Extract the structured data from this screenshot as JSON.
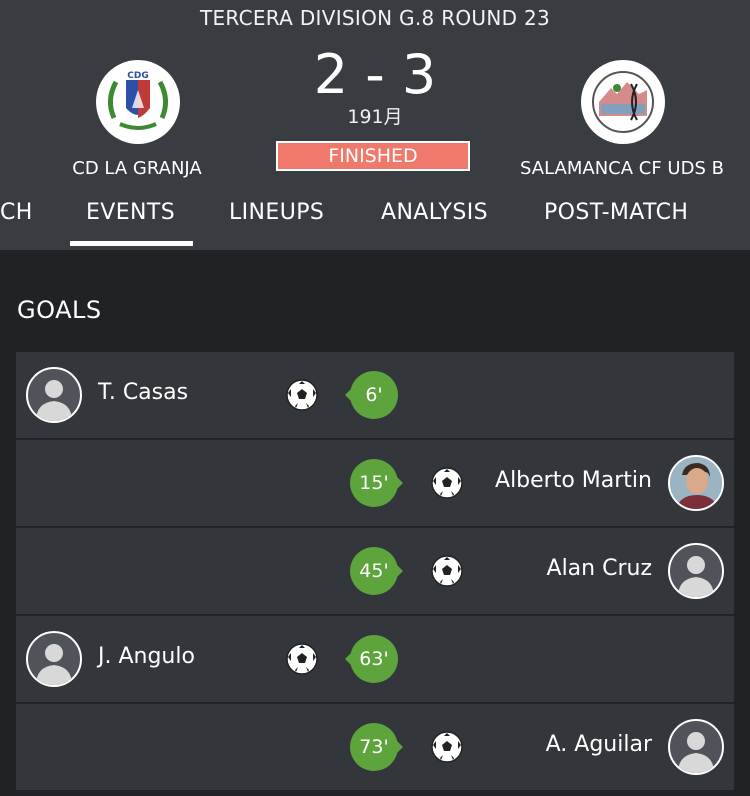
{
  "match": {
    "competition": "TERCERA DIVISION G.8 ROUND 23",
    "score": "2 - 3",
    "date": "191月",
    "status": "FINISHED",
    "status_color": "#ef7a6b"
  },
  "home_team": {
    "name": "CD LA GRANJA",
    "crest_text": "CDG",
    "crest_icon": "cd-la-granja-crest"
  },
  "away_team": {
    "name": "SALAMANCA CF UDS B",
    "crest_icon": "salamanca-crest"
  },
  "tabs": [
    {
      "label": "CH",
      "active": false
    },
    {
      "label": "EVENTS",
      "active": true
    },
    {
      "label": "LINEUPS",
      "active": false
    },
    {
      "label": "ANALYSIS",
      "active": false
    },
    {
      "label": "POST-MATCH",
      "active": false
    }
  ],
  "goals_section": {
    "title": "GOALS",
    "accent_color": "#5ea43c",
    "goals": [
      {
        "side": "home",
        "player": "T. Casas",
        "minute": "6'",
        "avatar": "default-player-avatar"
      },
      {
        "side": "away",
        "player": "Alberto Martin",
        "minute": "15'",
        "avatar": "player-photo"
      },
      {
        "side": "away",
        "player": "Alan Cruz",
        "minute": "45'",
        "avatar": "default-player-avatar"
      },
      {
        "side": "home",
        "player": "J. Angulo",
        "minute": "63'",
        "avatar": "default-player-avatar"
      },
      {
        "side": "away",
        "player": "A. Aguilar",
        "minute": "73'",
        "avatar": "default-player-avatar"
      }
    ]
  }
}
